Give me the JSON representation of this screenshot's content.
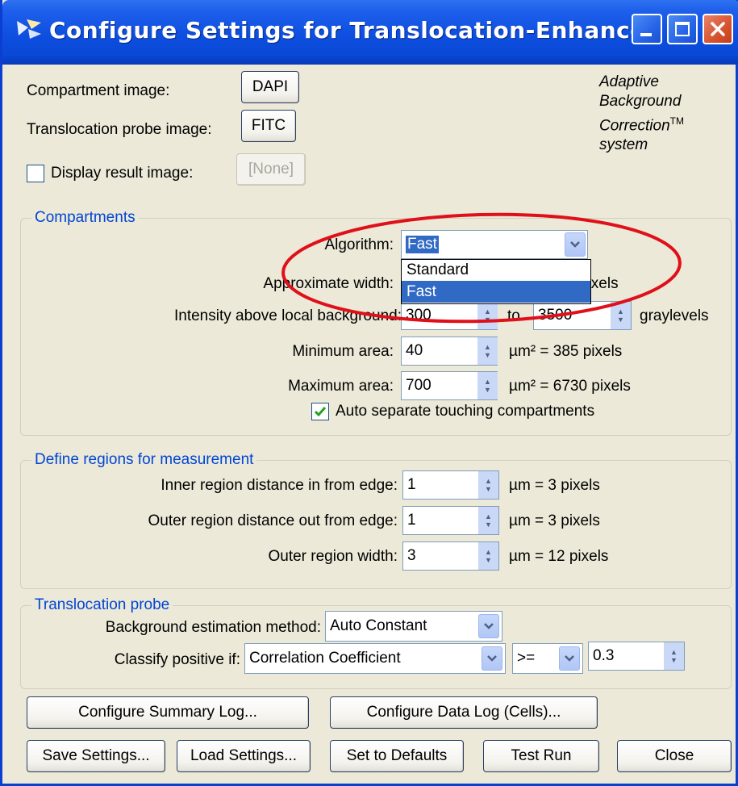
{
  "window": {
    "title": "Configure Settings for Translocation-Enhanced"
  },
  "top": {
    "compartment_label": "Compartment image:",
    "compartment_value": "DAPI",
    "probe_label": "Translocation probe image:",
    "probe_value": "FITC",
    "display_result_label": "Display result image:",
    "display_result_value": "[None]",
    "display_result_checked": false,
    "abc_line1": "Adaptive",
    "abc_line2": "Background",
    "abc_line3": "Correction",
    "abc_tm": "TM",
    "abc_line4": "system"
  },
  "compartments": {
    "title": "Compartments",
    "algorithm_label": "Algorithm:",
    "algorithm_value": "Fast",
    "algorithm_options": [
      "Standard",
      "Fast"
    ],
    "approx_width_label": "Approximate width:",
    "approx_width_unit": "pixels",
    "intensity_label": "Intensity above local background:",
    "intensity_min": "300",
    "intensity_to": "to",
    "intensity_max": "3500",
    "intensity_unit": "graylevels",
    "min_area_label": "Minimum area:",
    "min_area_value": "40",
    "min_area_unit": "µm² = 385 pixels",
    "max_area_label": "Maximum area:",
    "max_area_value": "700",
    "max_area_unit": "µm² = 6730 pixels",
    "auto_separate_label": "Auto separate touching compartments",
    "auto_separate_checked": true
  },
  "regions": {
    "title": "Define regions for measurement",
    "inner_label": "Inner region distance in from edge:",
    "inner_value": "1",
    "inner_unit": "µm = 3 pixels",
    "outer_label": "Outer region distance out from edge:",
    "outer_value": "1",
    "outer_unit": "µm = 3 pixels",
    "width_label": "Outer region width:",
    "width_value": "3",
    "width_unit": "µm = 12 pixels"
  },
  "probe": {
    "title": "Translocation probe",
    "bg_method_label": "Background estimation method:",
    "bg_method_value": "Auto Constant",
    "classify_label": "Classify positive if:",
    "classify_value": "Correlation Coefficient",
    "operator_value": ">=",
    "threshold_value": "0.3"
  },
  "buttons": {
    "summary_log": "Configure Summary Log...",
    "data_log": "Configure Data Log (Cells)...",
    "save": "Save Settings...",
    "load": "Load Settings...",
    "defaults": "Set to Defaults",
    "test_run": "Test Run",
    "close": "Close"
  },
  "colors": {
    "window_face": "#ECE9D8",
    "titlebar": "#0A48D6",
    "group_title": "#0046D5",
    "selection": "#316AC5",
    "annotation_ellipse": "#E0101A"
  }
}
